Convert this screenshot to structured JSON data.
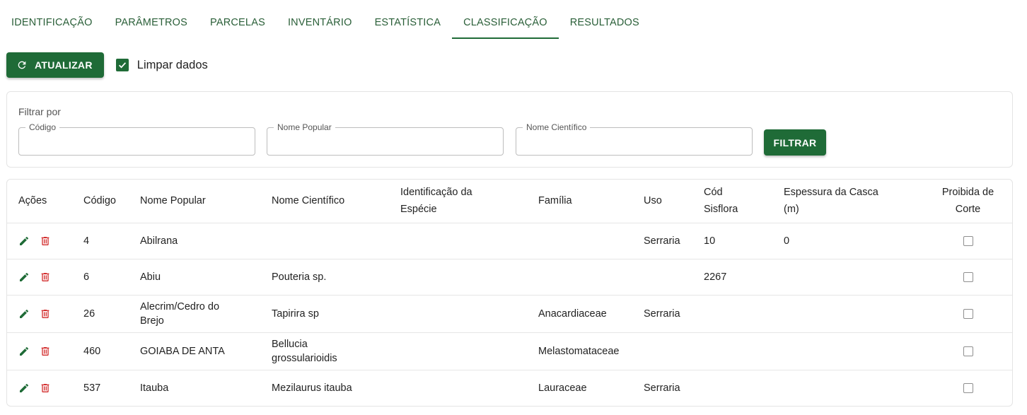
{
  "tabs": [
    {
      "label": "IDENTIFICAÇÃO"
    },
    {
      "label": "PARÂMETROS"
    },
    {
      "label": "PARCELAS"
    },
    {
      "label": "INVENTÁRIO"
    },
    {
      "label": "ESTATÍSTICA"
    },
    {
      "label": "CLASSIFICAÇÃO",
      "active": true
    },
    {
      "label": "RESULTADOS"
    }
  ],
  "toolbar": {
    "refresh_label": "ATUALIZAR",
    "clear_label": "Limpar dados",
    "clear_checked": true
  },
  "filter": {
    "title": "Filtrar por",
    "fields": [
      {
        "label": "Código",
        "value": ""
      },
      {
        "label": "Nome Popular",
        "value": ""
      },
      {
        "label": "Nome Científico",
        "value": ""
      }
    ],
    "button_label": "FILTRAR"
  },
  "table": {
    "headers": {
      "acoes": "Ações",
      "codigo": "Código",
      "nome_popular": "Nome Popular",
      "nome_cientifico": "Nome Científico",
      "identificacao_line1": "Identificação da",
      "identificacao_line2": "Espécie",
      "familia": "Família",
      "uso": "Uso",
      "cod_sisflora_line1": "Cód",
      "cod_sisflora_line2": "Sisflora",
      "espessura_line1": "Espessura da Casca",
      "espessura_line2": "(m)",
      "proibida_line1": "Proibida de",
      "proibida_line2": "Corte"
    },
    "rows": [
      {
        "codigo": "4",
        "nome_popular": "Abilrana",
        "nome_cientifico": "",
        "identificacao": "",
        "familia": "",
        "uso": "Serraria",
        "cod_sisflora": "10",
        "espessura": "0",
        "proibida": false
      },
      {
        "codigo": "6",
        "nome_popular": "Abiu",
        "nome_cientifico": "Pouteria sp.",
        "identificacao": "",
        "familia": "",
        "uso": "",
        "cod_sisflora": "2267",
        "espessura": "",
        "proibida": false
      },
      {
        "codigo": "26",
        "nome_popular": "Alecrim/Cedro do Brejo",
        "nome_cientifico": "Tapirira sp",
        "identificacao": "",
        "familia": "Anacardiaceae",
        "uso": "Serraria",
        "cod_sisflora": "",
        "espessura": "",
        "proibida": false
      },
      {
        "codigo": "460",
        "nome_popular": "GOIABA DE ANTA",
        "nome_cientifico": "Bellucia grossularioidis",
        "identificacao": "",
        "familia": "Melastomataceae",
        "uso": "",
        "cod_sisflora": "",
        "espessura": "",
        "proibida": false
      },
      {
        "codigo": "537",
        "nome_popular": "Itauba",
        "nome_cientifico": "Mezilaurus itauba",
        "identificacao": "",
        "familia": "Lauraceae",
        "uso": "Serraria",
        "cod_sisflora": "",
        "espessura": "",
        "proibida": false
      }
    ]
  },
  "icons": {
    "refresh": "refresh-icon",
    "check": "check-icon",
    "edit": "pencil-icon",
    "delete": "trash-icon"
  },
  "colors": {
    "primary": "#1f6b37",
    "tab_text": "#2a5f38",
    "delete": "#d32f2f"
  }
}
